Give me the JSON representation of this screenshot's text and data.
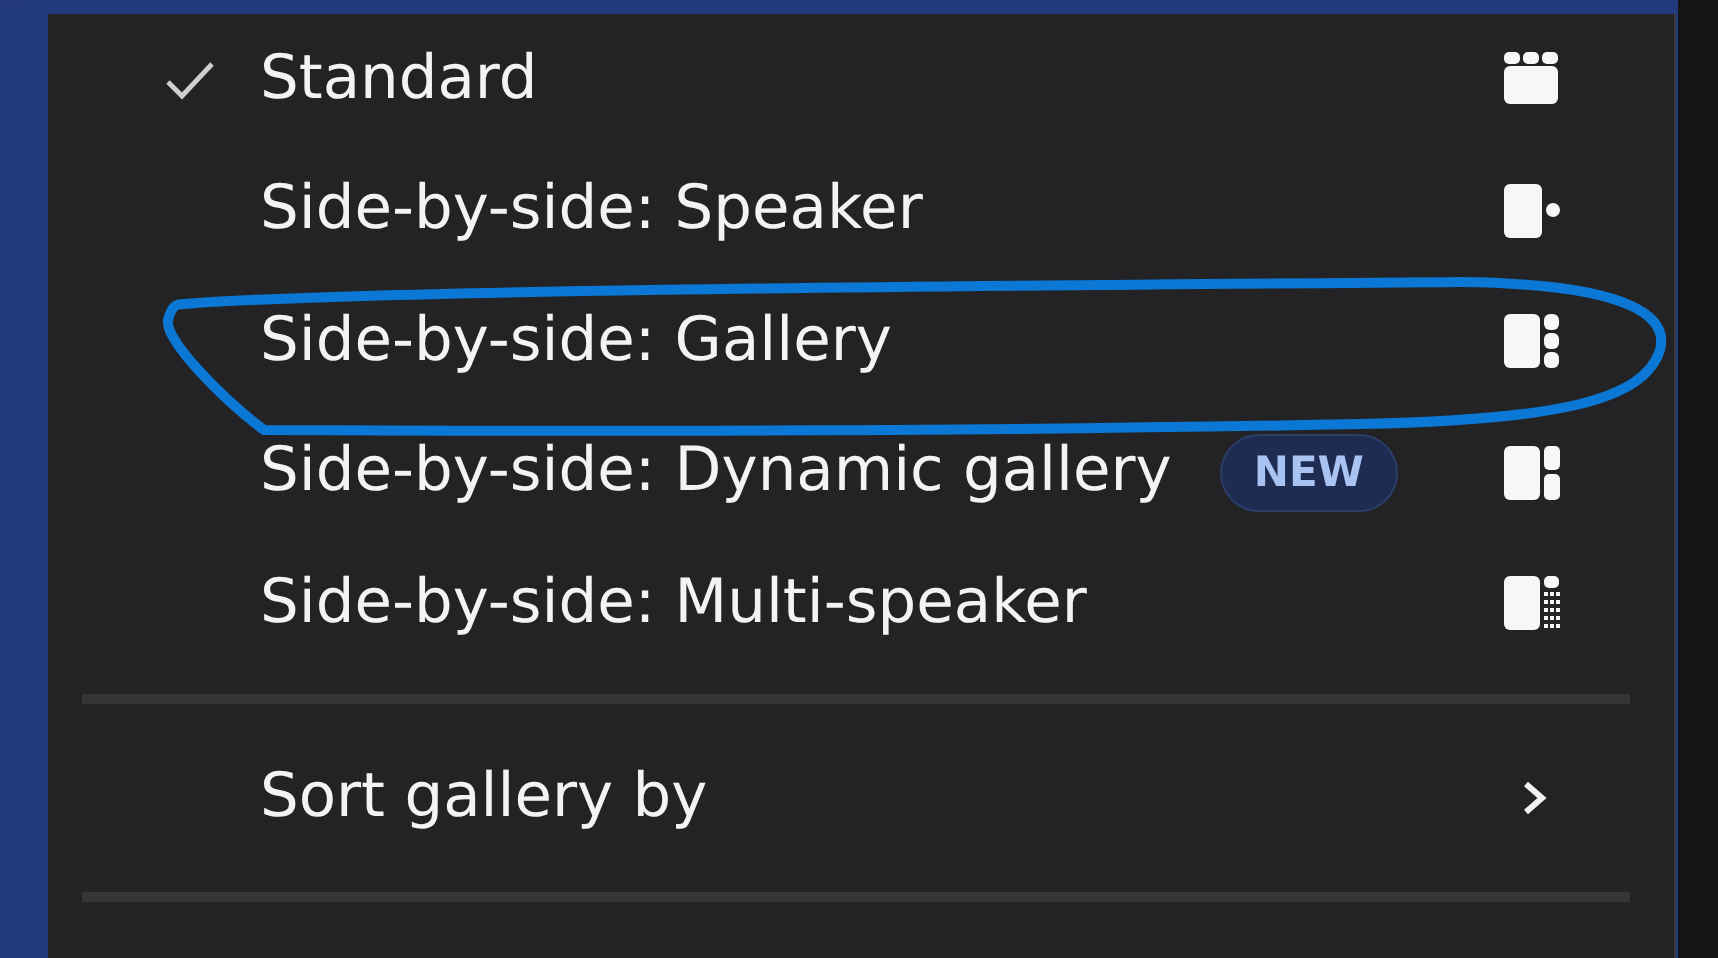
{
  "layout_options": [
    {
      "label": "Standard",
      "selected": true,
      "circled": false,
      "kind": "standard"
    },
    {
      "label": "Side-by-side: Speaker",
      "selected": false,
      "circled": false,
      "kind": "speaker"
    },
    {
      "label": "Side-by-side: Gallery",
      "selected": false,
      "circled": true,
      "kind": "gallery"
    },
    {
      "label": "Side-by-side: Dynamic gallery",
      "selected": false,
      "circled": false,
      "badge": "NEW",
      "kind": "dynamic"
    },
    {
      "label": "Side-by-side: Multi-speaker",
      "selected": false,
      "circled": false,
      "kind": "multi"
    }
  ],
  "submenu": {
    "label": "Sort gallery by"
  }
}
